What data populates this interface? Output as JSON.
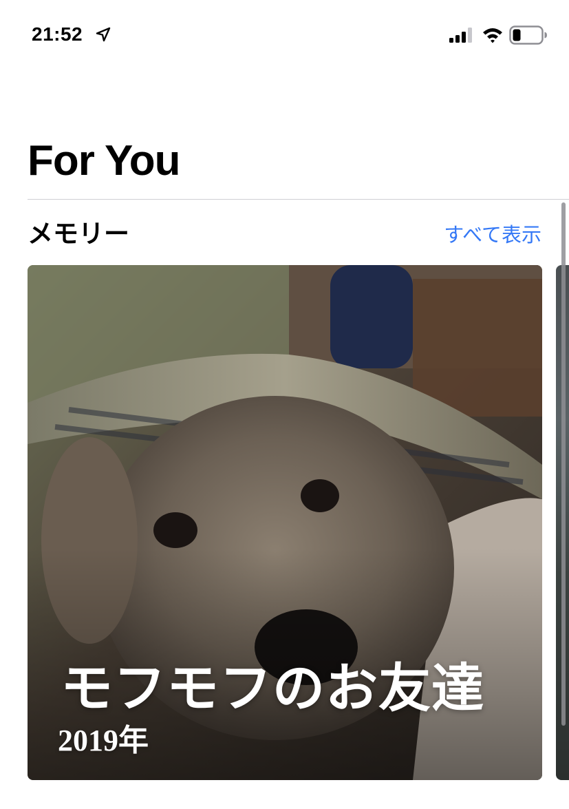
{
  "status_bar": {
    "time": "21:52",
    "icons": [
      "location-arrow-icon",
      "cellular-signal-icon",
      "wifi-icon",
      "battery-icon"
    ]
  },
  "header": {
    "title": "For You"
  },
  "memories": {
    "section_title": "メモリー",
    "see_all_label": "すべて表示",
    "see_all_color": "#3478f6",
    "cards": [
      {
        "title": "モフモフのお友達",
        "subtitle": "2019年"
      }
    ]
  }
}
